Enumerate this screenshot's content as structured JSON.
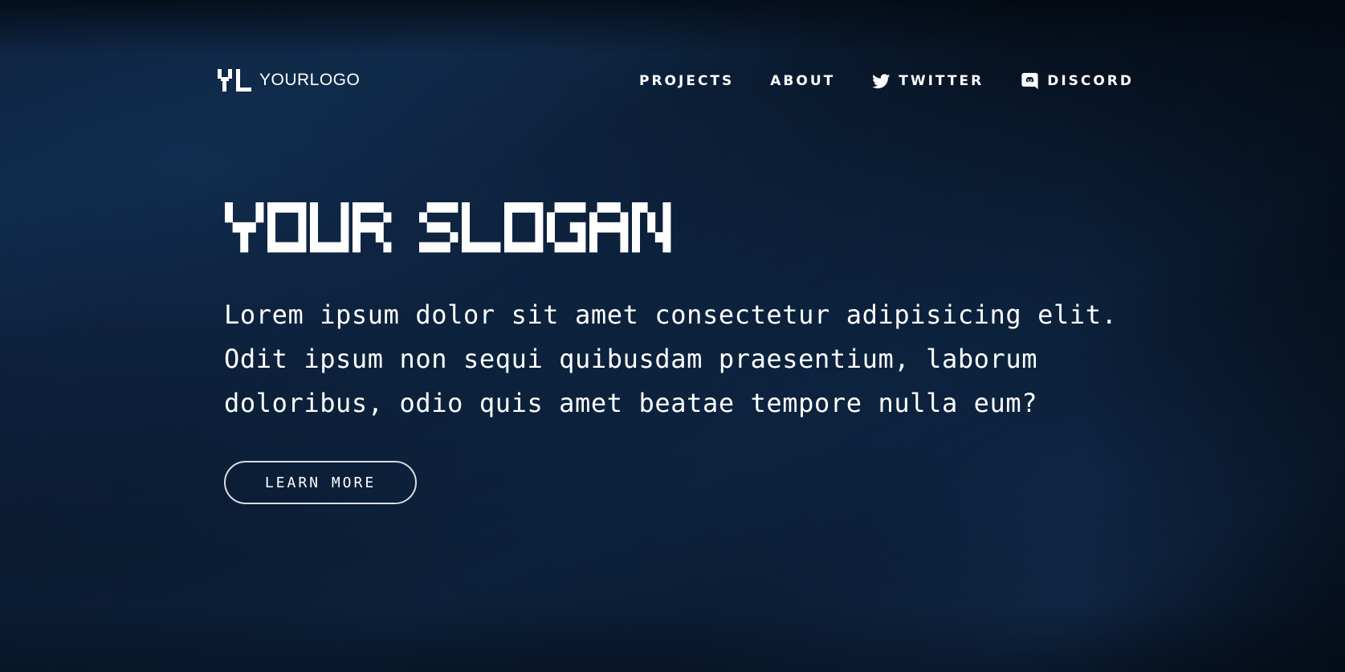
{
  "colors": {
    "background": "#06101d",
    "text": "#ffffff",
    "button_border": "#d9dde3"
  },
  "header": {
    "logo_text": "YOURLOGO",
    "logo_mark_icon": "pixel-yl-logo-icon",
    "nav": [
      {
        "label": "PROJECTS"
      },
      {
        "label": "ABOUT"
      },
      {
        "label": "TWITTER",
        "icon": "twitter-icon"
      },
      {
        "label": "DISCORD",
        "icon": "discord-icon"
      }
    ]
  },
  "hero": {
    "slogan": "YOUR SLOGAN",
    "description_lines": [
      "Lorem ipsum dolor sit amet consectetur adipisicing elit.",
      "Odit ipsum non sequi quibusdam praesentium, laborum",
      "doloribus, odio quis amet beatae tempore nulla eum?"
    ],
    "cta_label": "LEARN MORE"
  }
}
